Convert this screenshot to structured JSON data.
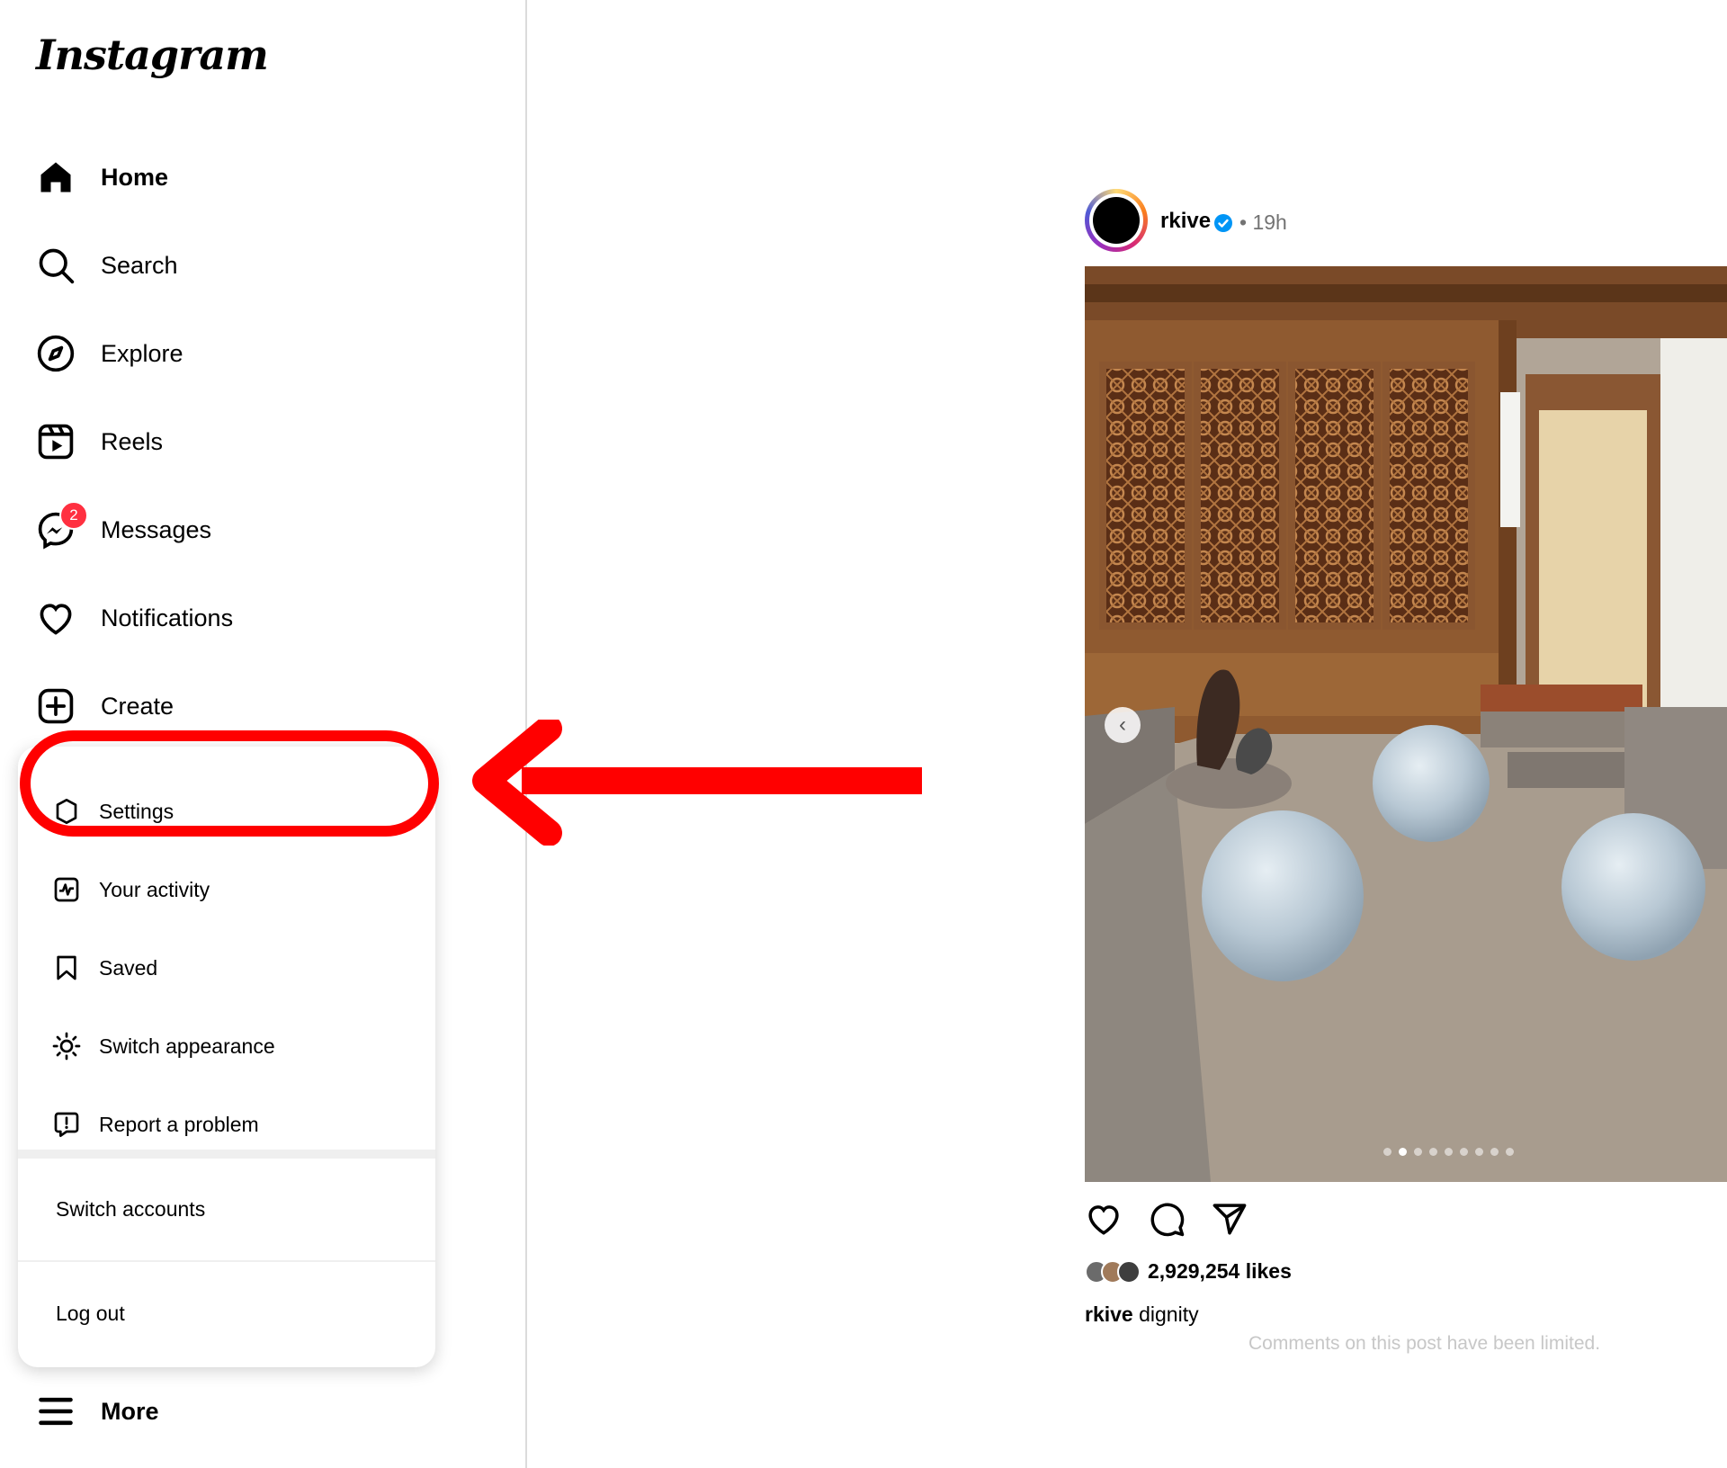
{
  "app": {
    "logo_text": "Instagram"
  },
  "nav": {
    "home": "Home",
    "search": "Search",
    "explore": "Explore",
    "reels": "Reels",
    "messages": "Messages",
    "messages_badge": "2",
    "notifications": "Notifications",
    "create": "Create",
    "more": "More"
  },
  "more_menu": {
    "settings": "Settings",
    "your_activity": "Your activity",
    "saved": "Saved",
    "switch_appearance": "Switch appearance",
    "report_problem": "Report a problem",
    "switch_accounts": "Switch accounts",
    "log_out": "Log out"
  },
  "post": {
    "username": "rkive",
    "time": "19h",
    "separator": "•",
    "likes": "2,929,254 likes",
    "caption_user": "rkive",
    "caption_text": "dignity",
    "comments_notice": "Comments on this post have been limited.",
    "carousel_count": 9,
    "carousel_active_index": 1
  },
  "colors": {
    "annotation_red": "#ff0000",
    "badge_red": "#ff3040",
    "verified_blue": "#0095f6"
  },
  "icons": {
    "home": "home-icon",
    "search": "search-icon",
    "explore": "compass-icon",
    "reels": "reels-icon",
    "messages": "messenger-icon",
    "notifications": "heart-icon",
    "create": "plus-square-icon",
    "settings": "gear-icon",
    "activity": "activity-icon",
    "saved": "bookmark-icon",
    "appearance": "sun-icon",
    "report": "report-icon",
    "more": "hamburger-icon"
  }
}
